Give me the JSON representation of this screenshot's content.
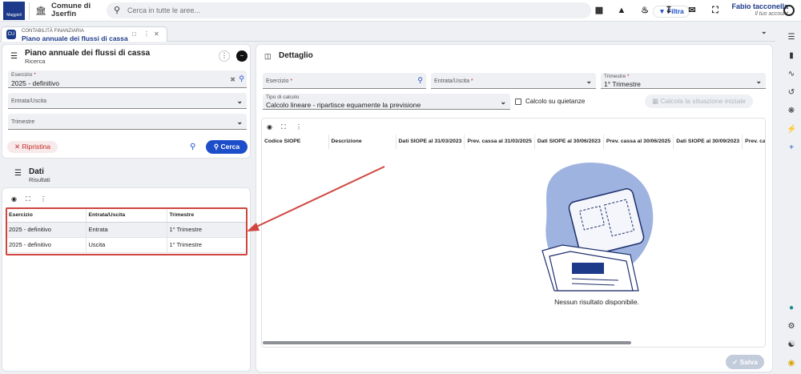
{
  "header": {
    "logo_text": "Maggioli",
    "entity_name": "Comune di Jserfin",
    "search_placeholder": "Cerca in tutte le aree...",
    "filter_label": "Filtra",
    "user_name": "Fabio tacconella",
    "user_role": "Il tuo account"
  },
  "tab": {
    "badge": "CU",
    "module": "CONTABILITÀ FINANZIARIA",
    "title": "Piano annuale dei flussi di cassa"
  },
  "left": {
    "title": "Piano annuale dei flussi di cassa",
    "subtitle": "Ricerca",
    "fields": {
      "esercizio_label": "Esercizio",
      "esercizio_value": "2025 - definitivo",
      "entrata_placeholder": "Entrata/Uscita",
      "trimestre_placeholder": "Trimestre"
    },
    "reset_label": "Ripristina",
    "search_label": "Cerca",
    "results_title": "Dati",
    "results_subtitle": "Risultati",
    "table": {
      "columns": [
        "Esercizio",
        "Entrata/Uscita",
        "Trimestre"
      ],
      "rows": [
        [
          "2025 - definitivo",
          "Entrata",
          "1° Trimestre"
        ],
        [
          "2025 - definitivo",
          "Uscita",
          "1° Trimestre"
        ]
      ]
    }
  },
  "right": {
    "title": "Dettaglio",
    "fields": {
      "esercizio_label": "Esercizio",
      "entrata_label": "Entrata/Uscita",
      "trimestre_label": "Trimestre",
      "trimestre_value": "1° Trimestre",
      "tipo_label": "Tipo di calcolo",
      "tipo_value": "Calcolo lineare - ripartisce equamente la previsione",
      "quietanze_label": "Calcolo su quietanze"
    },
    "calc_label": "Calcola la situazione iniziale",
    "table": {
      "columns": [
        "Codice SIOPE",
        "Descrizione",
        "Dati SIOPE al 31/03/2023",
        "Prev. cassa al 31/03/2025",
        "Dati SIOPE al 30/06/2023",
        "Prev. cassa al 30/06/2025",
        "Dati SIOPE al 30/09/2023",
        "Prev. cass"
      ]
    },
    "empty_message": "Nessun risultato disponibile.",
    "save_label": "Salva"
  },
  "colors": {
    "primary": "#1d4ec9",
    "brand": "#1d3a8a",
    "danger": "#c62828",
    "annotation": "#d0453f"
  }
}
